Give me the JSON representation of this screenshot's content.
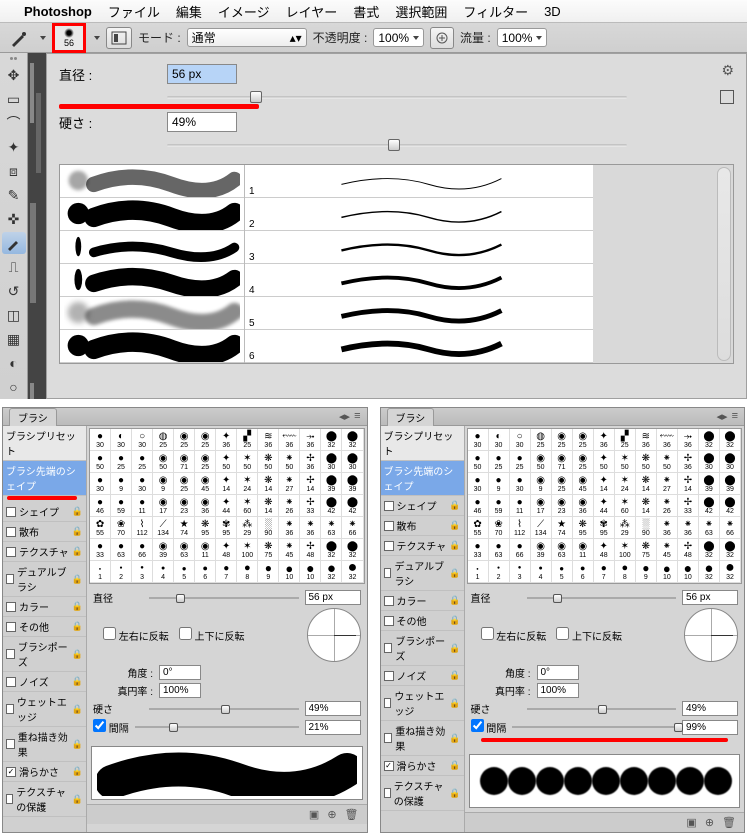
{
  "menubar": {
    "apple": "",
    "app": "Photoshop",
    "items": [
      "ファイル",
      "編集",
      "イメージ",
      "レイヤー",
      "書式",
      "選択範囲",
      "フィルター",
      "3D"
    ]
  },
  "optionsbar": {
    "brush_size_label": "56",
    "mode_label": "モード :",
    "mode_value": "通常",
    "opacity_label": "不透明度 :",
    "opacity_value": "100%",
    "flow_label": "流量 :",
    "flow_value": "100%"
  },
  "flyout": {
    "diameter_label": "直径 :",
    "diameter_value": "56 px",
    "hardness_label": "硬さ :",
    "hardness_value": "49%"
  },
  "stroke_list": {
    "rows": [
      "1",
      "2",
      "3",
      "4",
      "5",
      "6"
    ]
  },
  "brush_panel_common": {
    "title": "ブラシ",
    "preset_btn": "ブラシプリセット",
    "shape_tab": "ブラシ先端のシェイプ",
    "side_items": [
      {
        "label": "シェイプ",
        "cb": true,
        "lock": true
      },
      {
        "label": "散布",
        "cb": true,
        "lock": true
      },
      {
        "label": "テクスチャ",
        "cb": true,
        "lock": true
      },
      {
        "label": "デュアルブラシ",
        "cb": true,
        "lock": true
      },
      {
        "label": "カラー",
        "cb": true,
        "lock": true
      },
      {
        "label": "その他",
        "cb": true,
        "lock": true
      },
      {
        "label": "ブラシポーズ",
        "cb": true,
        "lock": true
      },
      {
        "label": "ノイズ",
        "cb": true,
        "lock": true
      },
      {
        "label": "ウェットエッジ",
        "cb": true,
        "lock": true
      },
      {
        "label": "重ね描き効果",
        "cb": true,
        "lock": true
      },
      {
        "label": "滑らかさ",
        "cb": true,
        "checked": true,
        "lock": true
      },
      {
        "label": "テクスチャの保護",
        "cb": true,
        "lock": true
      }
    ],
    "swatch_labels_row1": [
      "30",
      "30",
      "30",
      "25",
      "25",
      "25",
      "36",
      "25",
      "36",
      "36",
      "36",
      "32",
      "32"
    ],
    "swatch_labels_row2": [
      "50",
      "25",
      "25",
      "50",
      "71",
      "25",
      "50",
      "50",
      "50",
      "50",
      "36",
      "30",
      "30"
    ],
    "swatch_labels_row3": [
      "30",
      "9",
      "30",
      "9",
      "25",
      "45",
      "14",
      "24",
      "14",
      "27",
      "14",
      "39",
      "39"
    ],
    "swatch_labels_row4": [
      "46",
      "59",
      "11",
      "17",
      "23",
      "36",
      "44",
      "60",
      "14",
      "26",
      "33",
      "42",
      "42"
    ],
    "swatch_labels_row5": [
      "55",
      "70",
      "112",
      "134",
      "74",
      "95",
      "95",
      "29",
      "90",
      "36",
      "36",
      "63",
      "66"
    ],
    "swatch_labels_row6": [
      "33",
      "63",
      "66",
      "39",
      "63",
      "11",
      "48",
      "100",
      "75",
      "45",
      "48",
      "32",
      "32"
    ],
    "swatch_labels_row7": [
      "1",
      "2",
      "3",
      "4",
      "5",
      "6",
      "7",
      "8",
      "9",
      "10",
      "10",
      "32",
      "32"
    ],
    "diameter_label": "直径",
    "diameter_value": "56 px",
    "flipx_label": "左右に反転",
    "flipy_label": "上下に反転",
    "angle_label": "角度 :",
    "angle_value": "0°",
    "round_label": "真円率 :",
    "round_value": "100%",
    "hardness_label": "硬さ",
    "hardness_value": "49%",
    "spacing_label": "間隔"
  },
  "panel_left": {
    "spacing_value": "21%"
  },
  "panel_right": {
    "spacing_value": "99%"
  }
}
